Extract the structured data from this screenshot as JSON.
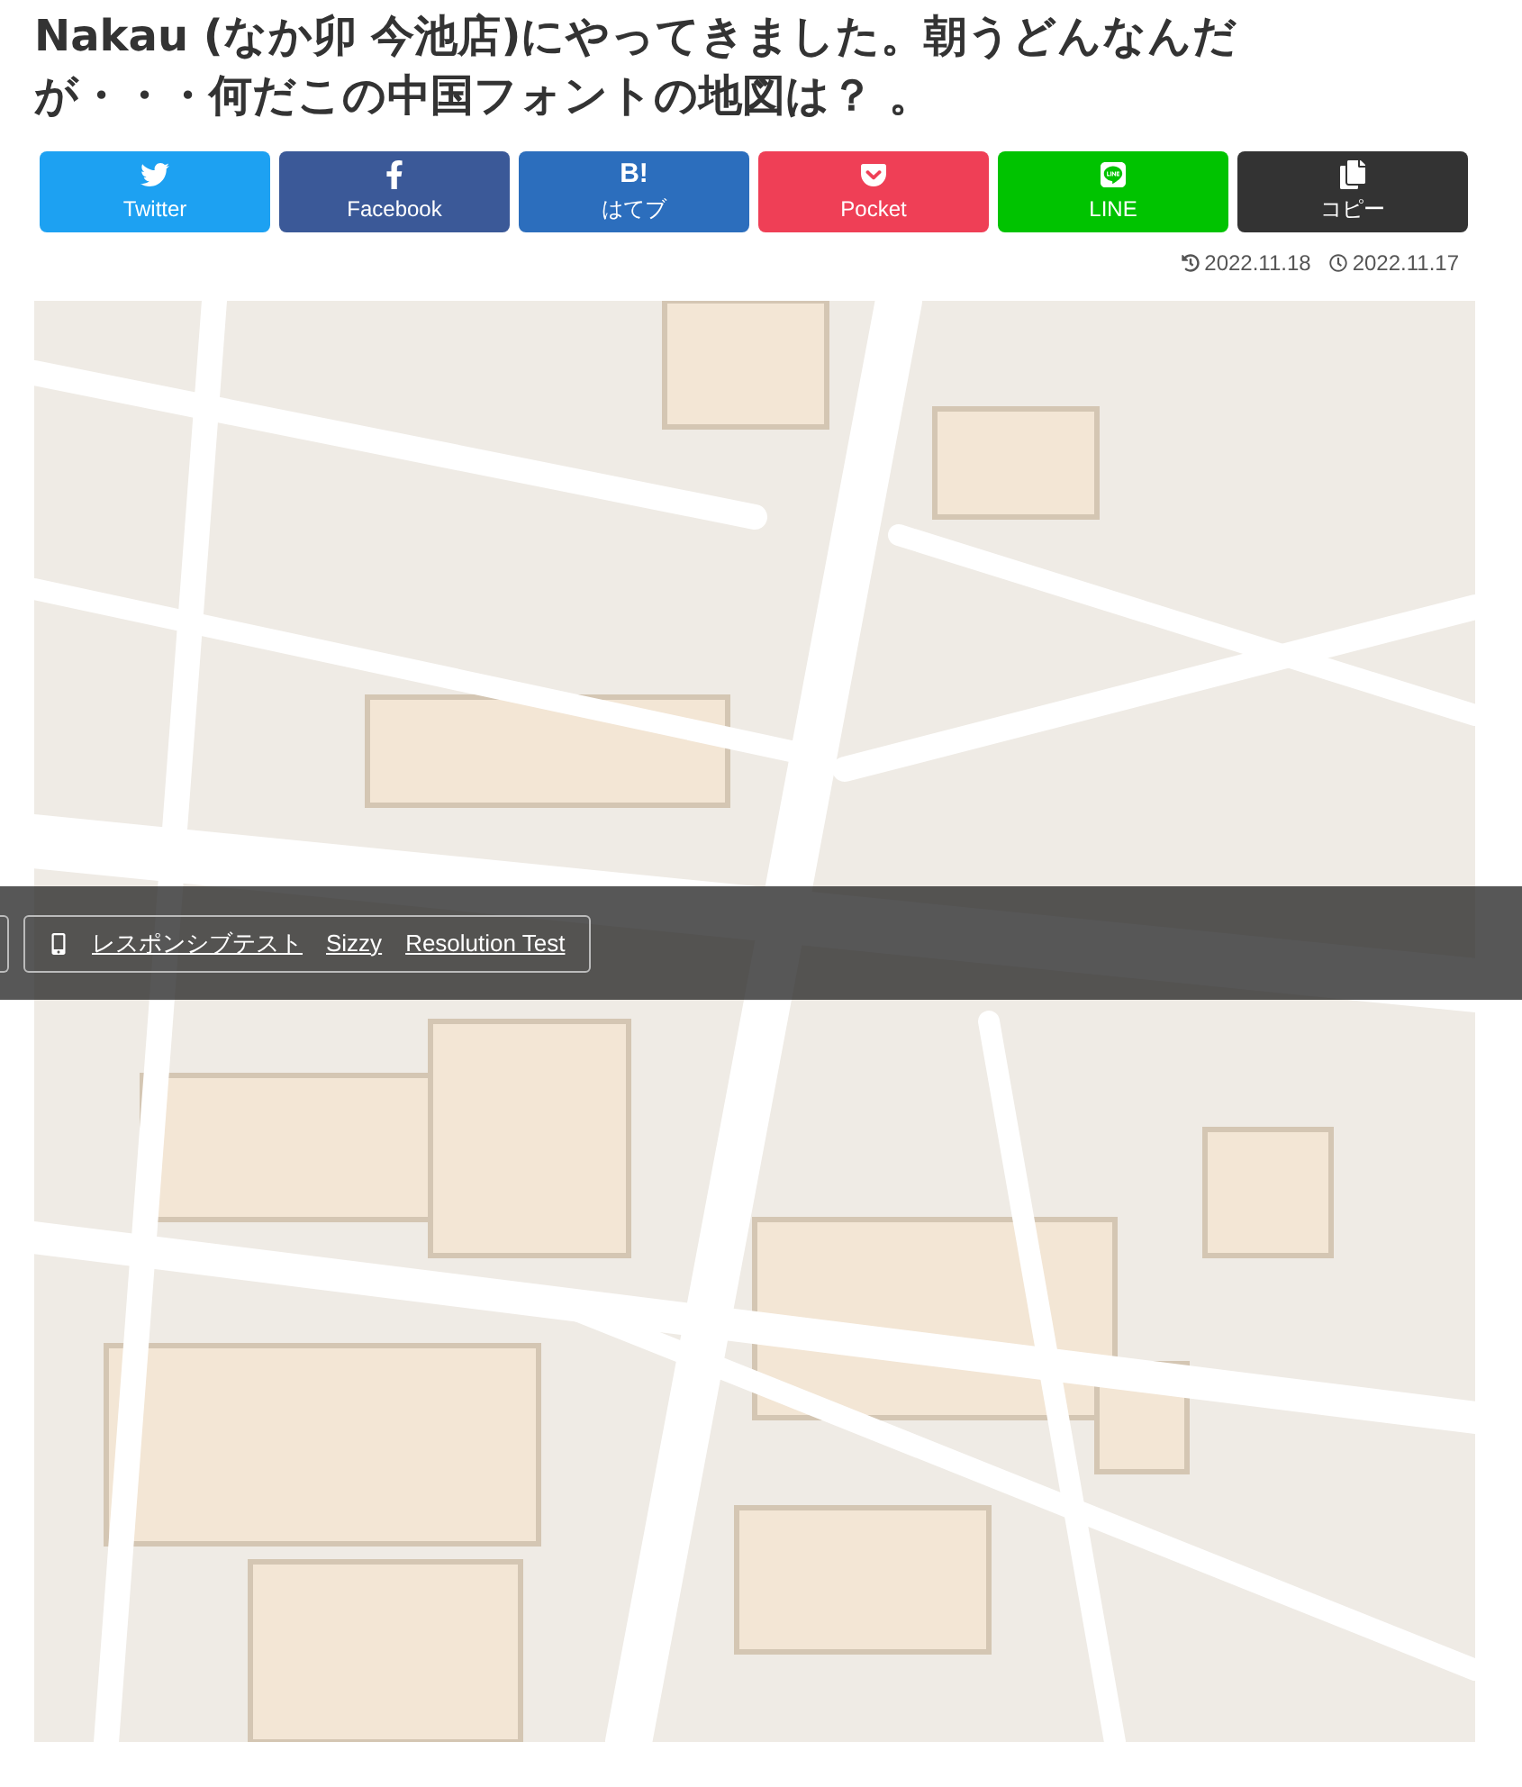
{
  "title": "Nakau (なか卯 今池店)にやってきました。朝うどんなんだが・・・何だこの中国フォントの地図は？ 。",
  "share_buttons": [
    {
      "kind": "twitter",
      "label": "Twitter"
    },
    {
      "kind": "facebook",
      "label": "Facebook"
    },
    {
      "kind": "hatena",
      "label": "はてブ",
      "icon_text": "B!"
    },
    {
      "kind": "pocket",
      "label": "Pocket"
    },
    {
      "kind": "line",
      "label": "LINE"
    },
    {
      "kind": "copy",
      "label": "コピー"
    }
  ],
  "dates": [
    {
      "kind": "updated",
      "text": "2022.11.18"
    },
    {
      "kind": "published",
      "text": "2022.11.17"
    }
  ],
  "test_bar": {
    "links": [
      "レスポンシブテスト",
      "Sizzy",
      "Resolution Test"
    ]
  }
}
